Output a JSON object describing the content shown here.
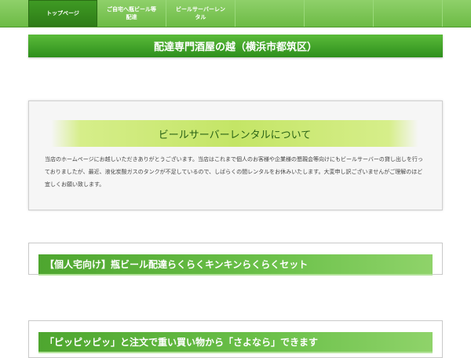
{
  "nav": {
    "items": [
      {
        "label": "トップページ",
        "active": true
      },
      {
        "label": "ご自宅へ瓶ビール等\n配達",
        "active": false
      },
      {
        "label": "ビールサーバーレン\nタル",
        "active": false
      }
    ]
  },
  "site_title": "配達専門酒屋の越（横浜市都筑区）",
  "notice": {
    "heading": "ビールサーバーレンタルについて",
    "body": "当店のホームページにお越しいただきありがとうございます。当店はこれまで個人のお客様や企業様の懇親会等向けにもビールサーバーの貸し出しを行っておりましたが、最近、液化炭酸ガスのタンクが不足しているので、しばらくの間レンタルをお休みいたします。大変申し訳ございませんがご理解のほど宜しくお願い致します。"
  },
  "sections": [
    {
      "heading": "【個人宅向け】瓶ビール配達らくらくキンキンらくらくセット"
    },
    {
      "heading": "「ピッピッピッ」と注文で重い買い物から「さよなら」できます"
    }
  ],
  "colors": {
    "nav_bg": "#6cbb45",
    "nav_active": "#2e7d17",
    "title_band": "#2e8f1c",
    "banner": "#c4e566"
  }
}
